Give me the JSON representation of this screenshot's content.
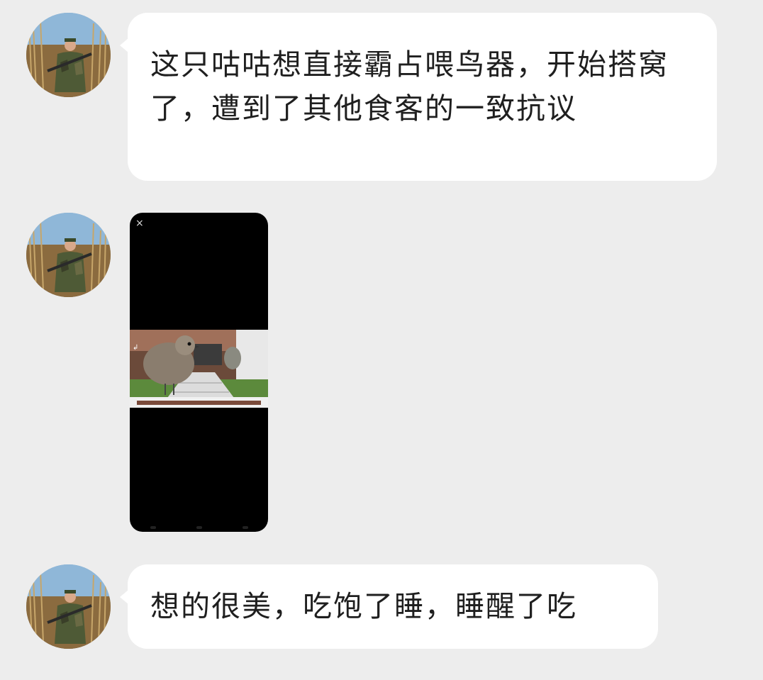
{
  "messages": [
    {
      "type": "text",
      "text": "这只咕咕想直接霸占喂鸟器，开始搭窝了，遭到了其他食客的一致抗议"
    },
    {
      "type": "video",
      "close_glyph": "×"
    },
    {
      "type": "text",
      "text": "想的很美，吃饱了睡，睡醒了吃"
    }
  ],
  "colors": {
    "background": "#ededed",
    "bubble": "#ffffff",
    "text": "#1f1f1f",
    "video_bg": "#000000"
  },
  "icons": {
    "avatar": "hunter-avatar",
    "video_close": "close-icon"
  }
}
